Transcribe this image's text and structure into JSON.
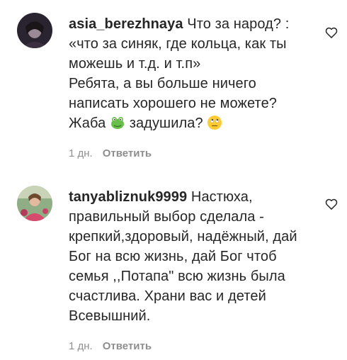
{
  "comments": [
    {
      "username": "asia_berezhnaya",
      "lines": [
        "Что за народ? :",
        "«что за синяк, где кольца, как ты",
        "можешь и т.д. и т.п»",
        "Ребята, а вы больше ничего",
        "написать хорошего не можете?"
      ],
      "last_line_start": "Жаба",
      "last_line_middle": "задушила?",
      "emoji_1": "frog-emoji",
      "emoji_2": "face-with-rolling-eyes-emoji",
      "time": "1 дн.",
      "reply_label": "Ответить",
      "like_icon": "heart-outline-icon"
    },
    {
      "username": "tanyabliznuk9999",
      "lines": [
        "Настюха,",
        "правильный выбор сделала -",
        "крепкий,здоровый, надёжный, дай",
        "Бог на всю жизнь, дай Бог чтоб",
        "семья ,,Потапа\" всю жизнь была",
        "счастлива. Храни вас и детей",
        "Всевышний."
      ],
      "time": "1 дн.",
      "reply_label": "Ответить",
      "like_icon": "heart-outline-icon"
    }
  ],
  "colors": {
    "text": "#262626",
    "secondary": "#8e8e8e",
    "background": "#ffffff"
  }
}
